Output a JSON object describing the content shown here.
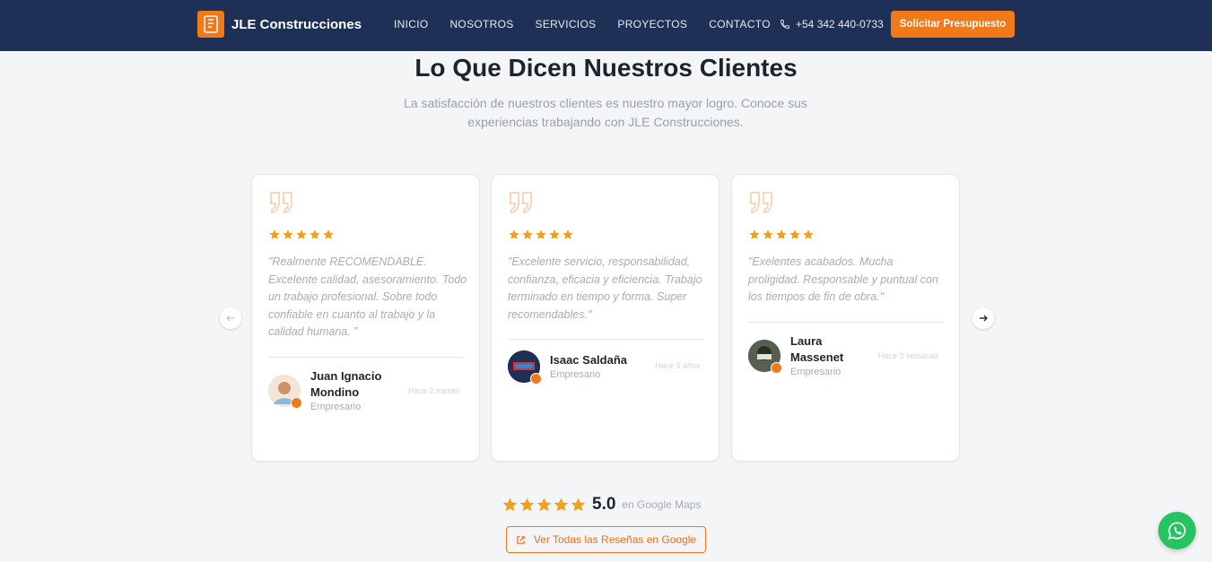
{
  "colors": {
    "navbar": "#1e3056",
    "accent": "#f07a1a",
    "star": "#f0a019",
    "whatsapp": "#25c461"
  },
  "navbar": {
    "brand": "JLE Construcciones",
    "links": [
      "INICIO",
      "NOSOTROS",
      "SERVICIOS",
      "PROYECTOS",
      "CONTACTO"
    ],
    "phone": "+54 342 440-0733",
    "cta": "Solicitar Presupuesto"
  },
  "section": {
    "title": "Lo Que Dicen Nuestros Clientes",
    "subtitle": "La satisfacción de nuestros clientes es nuestro mayor logro. Conoce sus experiencias trabajando con JLE Construcciones."
  },
  "reviews": [
    {
      "rating": 5,
      "text": "\"Realmente RECOMENDABLE. Excelente calidad, asesoramiento. Todo un trabajo profesional. Sobre todo confiable en cuanto al trabajo y la calidad humana. \"",
      "name": "Juan Ignacio Mondino",
      "role": "Empresario",
      "time": "Hace 2 meses"
    },
    {
      "rating": 5,
      "text": "\"Excelente servicio, responsabilidad, confianza, eficacia y eficiencia. Trabajo terminado en tiempo y forma. Super recomendables.\"",
      "name": "Isaac Saldaña",
      "role": "Empresario",
      "time": "Hace 3 años"
    },
    {
      "rating": 5,
      "text": "\"Exelentes acabados. Mucha proligidad. Responsable y puntual con los tiempos de fin de obra.\"",
      "name": "Laura Massenet",
      "role": "Empresario",
      "time": "Hace 3 semanas"
    }
  ],
  "summary": {
    "rating": 5,
    "value": "5.0",
    "source": "en Google Maps",
    "button": "Ver Todas las Reseñas en Google"
  },
  "icons": [
    "logo-icon",
    "phone-icon",
    "quote-icon",
    "star-icon",
    "arrow-left-icon",
    "arrow-right-icon",
    "external-link-icon",
    "whatsapp-icon"
  ]
}
